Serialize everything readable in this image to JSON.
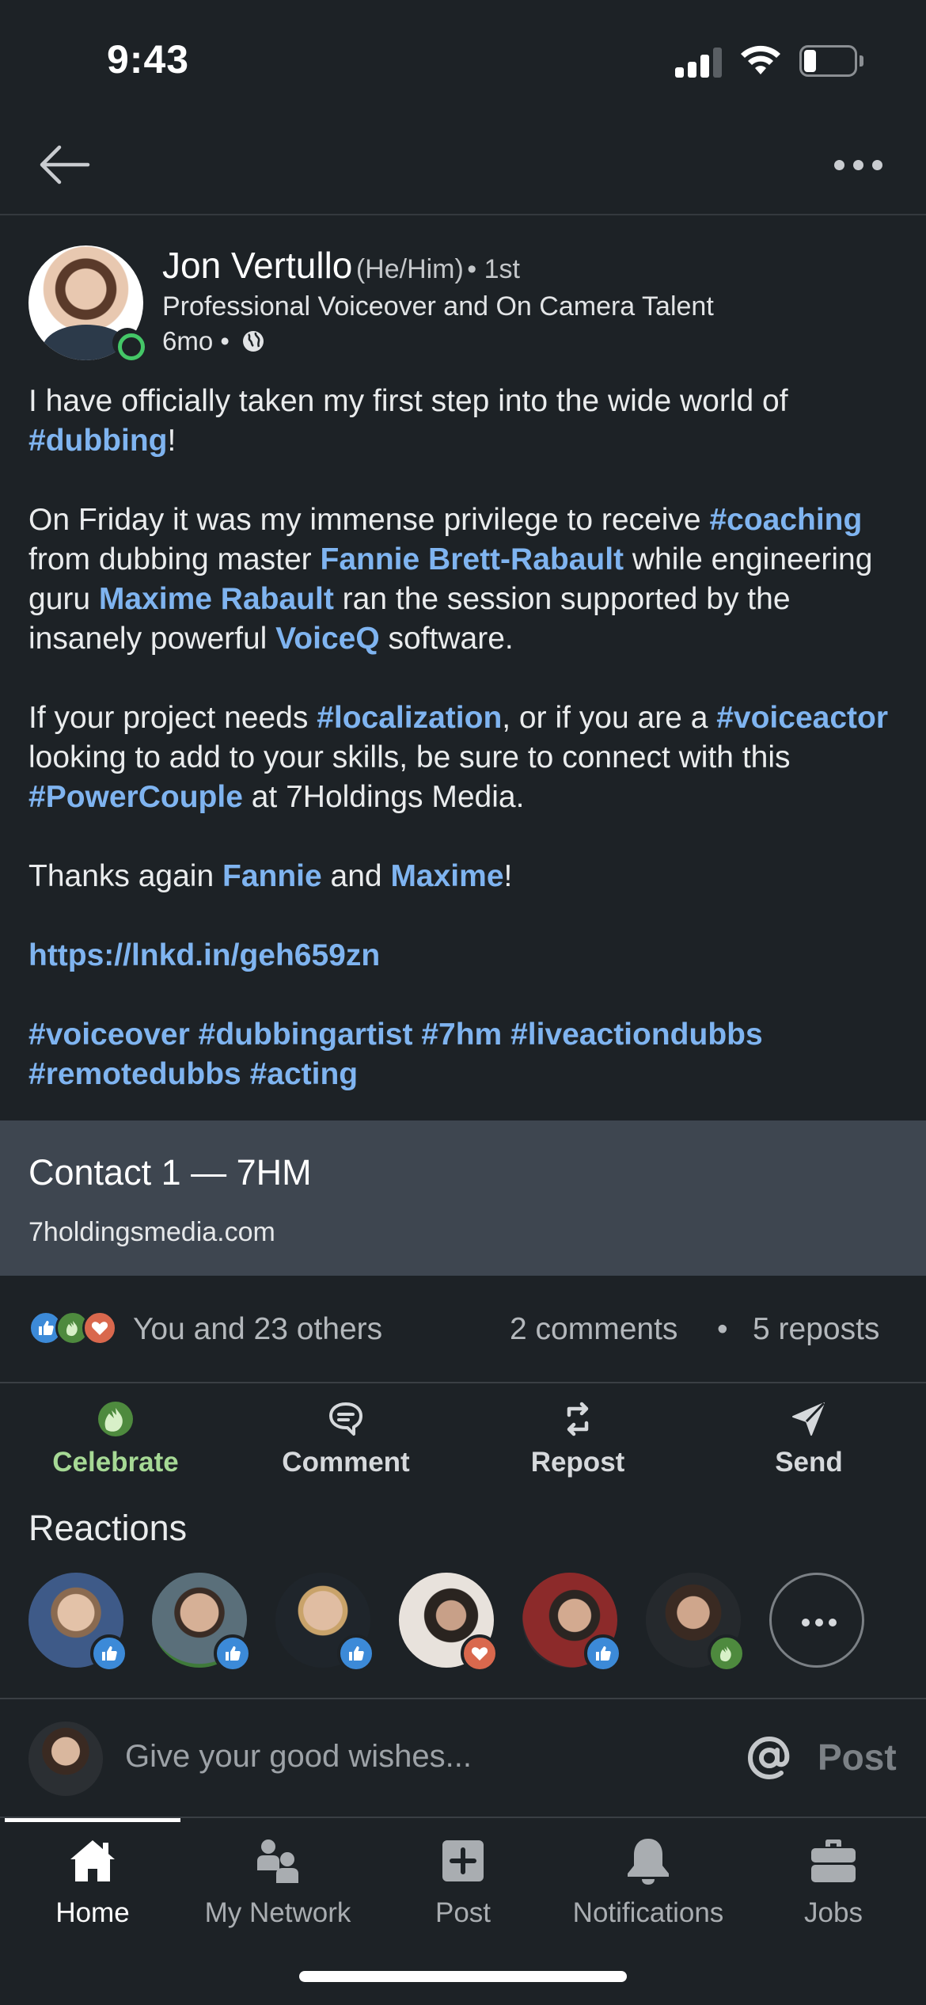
{
  "status_bar": {
    "time": "9:43"
  },
  "post": {
    "author": {
      "name": "Jon Vertullo",
      "pronouns": "(He/Him)",
      "degree": "• 1st",
      "headline": "Professional Voiceover and On Camera Talent",
      "age": "6mo •"
    },
    "body": {
      "p1_text": "I have officially taken my first step into the wide world of ",
      "p1_hashtag": "#dubbing",
      "p1_end": "!",
      "p2_text1": "On Friday it was my immense privilege to receive ",
      "p2_hashtag": "#coaching",
      "p2_text2": " from dubbing master ",
      "p2_mention1": "Fannie Brett-Rabault",
      "p2_text3": " while engineering guru ",
      "p2_mention2": "Maxime Rabault",
      "p2_text4": " ran the session supported by the insanely powerful ",
      "p2_mention3": "VoiceQ",
      "p2_text5": " software.",
      "p3_text1": "If your project needs ",
      "p3_hashtag1": "#localization",
      "p3_text2": ", or if you are a ",
      "p3_hashtag2": "#voiceactor",
      "p3_text3": " looking to add to your skills, be sure to connect with this ",
      "p3_hashtag3": "#PowerCouple",
      "p3_text4": " at 7Holdings Media.",
      "p4_text1": "Thanks again ",
      "p4_mention1": "Fannie",
      "p4_text2": " and ",
      "p4_mention2": "Maxime",
      "p4_end": "!",
      "url": "https://lnkd.in/geh659zn",
      "hashtags": [
        "#voiceover",
        "#dubbingartist",
        "#7hm",
        "#liveactiondubbs",
        "#remotedubbs",
        "#acting"
      ]
    },
    "link_preview": {
      "title": "Contact 1 — 7HM",
      "domain": "7holdingsmedia.com"
    },
    "counts": {
      "reactions": "You and 23 others",
      "comments": "2 comments",
      "separator": "•",
      "reposts": "5 reposts"
    },
    "actions": [
      {
        "label": "Celebrate",
        "icon": "celebrate-icon"
      },
      {
        "label": "Comment",
        "icon": "comment-icon"
      },
      {
        "label": "Repost",
        "icon": "repost-icon"
      },
      {
        "label": "Send",
        "icon": "send-icon"
      }
    ]
  },
  "reactions_section": {
    "title": "Reactions",
    "reactors": [
      {
        "reaction": "like"
      },
      {
        "reaction": "like"
      },
      {
        "reaction": "like"
      },
      {
        "reaction": "love"
      },
      {
        "reaction": "like"
      },
      {
        "reaction": "celebrate"
      }
    ]
  },
  "composer": {
    "placeholder": "Give your good wishes...",
    "post_label": "Post"
  },
  "tab_bar": {
    "tabs": [
      {
        "label": "Home",
        "icon": "home-icon",
        "active": true
      },
      {
        "label": "My Network",
        "icon": "network-icon",
        "active": false
      },
      {
        "label": "Post",
        "icon": "post-icon",
        "active": false
      },
      {
        "label": "Notifications",
        "icon": "bell-icon",
        "active": false
      },
      {
        "label": "Jobs",
        "icon": "briefcase-icon",
        "active": false
      }
    ]
  },
  "colors": {
    "background": "#1d2226",
    "link": "#7fb4f0",
    "celebrate_green": "#a6d995",
    "link_card": "#3e4650"
  }
}
